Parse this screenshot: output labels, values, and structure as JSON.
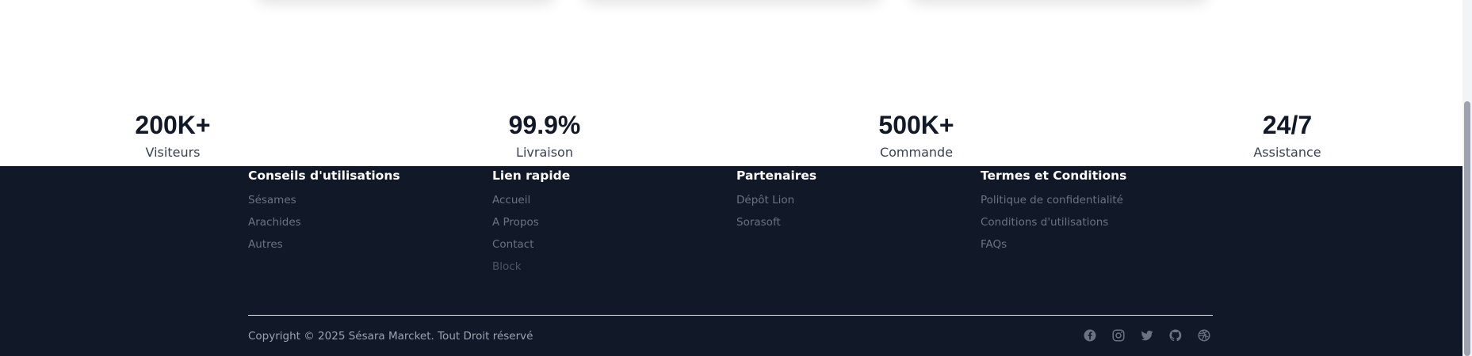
{
  "stats": [
    {
      "value": "200K+",
      "label": "Visiteurs"
    },
    {
      "value": "99.9%",
      "label": "Livraison"
    },
    {
      "value": "500K+",
      "label": "Commande"
    },
    {
      "value": "24/7",
      "label": "Assistance"
    }
  ],
  "footer": {
    "columns": [
      {
        "title": "Conseils d'utilisations",
        "links": [
          "Sésames",
          "Arachides",
          "Autres"
        ]
      },
      {
        "title": "Lien rapide",
        "links": [
          "Accueil",
          "A Propos",
          "Contact",
          "Block"
        ]
      },
      {
        "title": "Partenaires",
        "links": [
          "Dépôt Lion",
          "Sorasoft"
        ]
      },
      {
        "title": "Termes et Conditions",
        "links": [
          "Politique de confidentialité",
          "Conditions d'utilisations",
          "FAQs"
        ]
      }
    ],
    "copyright": "Copyright © 2025 Sésara Marcket. Tout Droit réservé",
    "social_icons": [
      "facebook-icon",
      "instagram-icon",
      "twitter-icon",
      "github-icon",
      "dribbble-icon"
    ]
  },
  "colors": {
    "footer_bg": "#111827",
    "stat_value": "#111827",
    "link": "#6b7280",
    "heading": "#ffffff"
  }
}
